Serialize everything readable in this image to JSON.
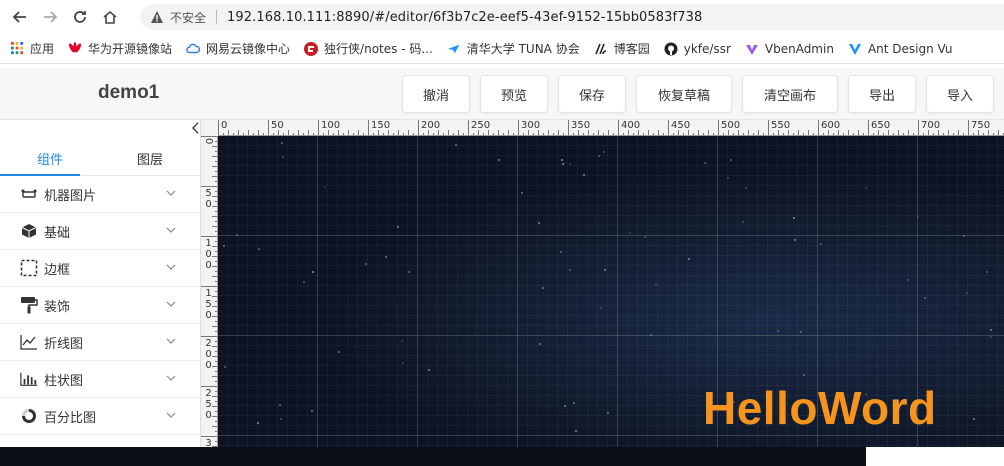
{
  "browser": {
    "insecure_label": "不安全",
    "url": "192.168.10.111:8890/#/editor/6f3b7c2e-eef5-43ef-9152-15bb0583f738"
  },
  "bookmarks": [
    {
      "label": "应用",
      "icon": "apps-grid-icon",
      "color": "#1a73e8"
    },
    {
      "label": "华为开源镜像站",
      "icon": "huawei-logo-icon",
      "color": "#e4002b"
    },
    {
      "label": "网易云镜像中心",
      "icon": "cloud-icon",
      "color": "#2f7de1"
    },
    {
      "label": "独行侠/notes - 码...",
      "icon": "gitee-logo-icon",
      "color": "#c71d23"
    },
    {
      "label": "清华大学 TUNA 协会",
      "icon": "tuna-logo-icon",
      "color": "#2196f3"
    },
    {
      "label": "博客园",
      "icon": "cnblogs-logo-icon",
      "color": "#222222"
    },
    {
      "label": "ykfe/ssr",
      "icon": "github-logo-icon",
      "color": "#222222"
    },
    {
      "label": "VbenAdmin",
      "icon": "vben-logo-icon",
      "color": "#9b5de5"
    },
    {
      "label": "Ant Design Vu",
      "icon": "antdv-logo-icon",
      "color": "#1890ff"
    }
  ],
  "header": {
    "title": "demo1",
    "buttons": [
      {
        "label": "撤消"
      },
      {
        "label": "预览"
      },
      {
        "label": "保存"
      },
      {
        "label": "恢复草稿"
      },
      {
        "label": "清空画布"
      },
      {
        "label": "导出"
      },
      {
        "label": "导入"
      }
    ]
  },
  "sidebar": {
    "tabs": [
      {
        "label": "组件",
        "active": true
      },
      {
        "label": "图层",
        "active": false
      }
    ],
    "items": [
      {
        "label": "机器图片",
        "icon": "robot-image-icon"
      },
      {
        "label": "基础",
        "icon": "cube-icon"
      },
      {
        "label": "边框",
        "icon": "dashed-border-icon"
      },
      {
        "label": "装饰",
        "icon": "paint-roller-icon"
      },
      {
        "label": "折线图",
        "icon": "line-chart-icon"
      },
      {
        "label": "柱状图",
        "icon": "bar-chart-icon"
      },
      {
        "label": "百分比图",
        "icon": "donut-chart-icon"
      }
    ]
  },
  "rulers": {
    "top_labels": [
      "0",
      "50",
      "100",
      "150",
      "200",
      "250",
      "300",
      "350",
      "400",
      "450",
      "500",
      "550",
      "600",
      "650",
      "700",
      "750"
    ],
    "left_labels": [
      "0",
      "50",
      "100",
      "150",
      "200",
      "250",
      "3"
    ]
  },
  "canvas": {
    "text": "HelloWord",
    "text_color": "#f7941d",
    "background": "#0c1322"
  },
  "colors": {
    "accent": "#1e88e5"
  }
}
